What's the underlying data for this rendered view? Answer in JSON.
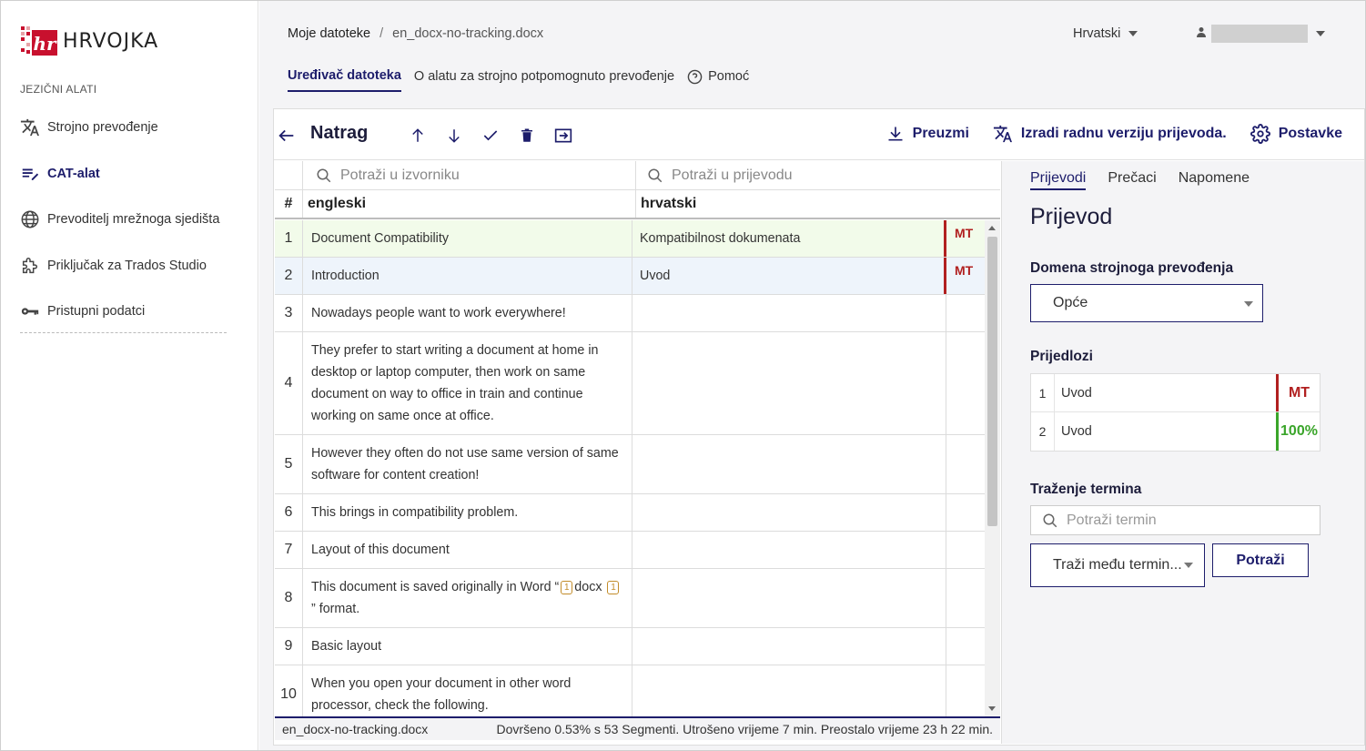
{
  "sidebar": {
    "logo_text": "HRVOJKA",
    "section_label": "JEZIČNI ALATI",
    "items": [
      {
        "label": "Strojno prevođenje",
        "icon": "translate-icon"
      },
      {
        "label": "CAT-alat",
        "icon": "edit-list-icon",
        "active": true
      },
      {
        "label": "Prevoditelj mrežnoga sjedišta",
        "icon": "globe-icon"
      },
      {
        "label": "Priključak za Trados Studio",
        "icon": "puzzle-icon"
      },
      {
        "label": "Pristupni podatci",
        "icon": "key-icon"
      }
    ]
  },
  "header": {
    "breadcrumb_root": "Moje datoteke",
    "breadcrumb_sep": "/",
    "breadcrumb_file": "en_docx-no-tracking.docx",
    "language": "Hrvatski",
    "tabs": [
      "Uređivač datoteka",
      "O alatu za strojno potpomognuto prevođenje",
      "Pomoć"
    ]
  },
  "toolbar": {
    "back_label": "Natrag",
    "download_label": "Preuzmi",
    "draft_label": "Izradi radnu verziju prijevoda.",
    "settings_label": "Postavke"
  },
  "grid": {
    "search_source_placeholder": "Potraži u izvorniku",
    "search_target_placeholder": "Potraži u prijevodu",
    "col_num": "#",
    "col_source": "engleski",
    "col_target": "hrvatski",
    "rows": [
      {
        "n": "1",
        "src": "Document Compatibility",
        "tgt": "Kompatibilnost dokumenata",
        "flag": "MT"
      },
      {
        "n": "2",
        "src": "Introduction",
        "tgt": "Uvod",
        "flag": "MT"
      },
      {
        "n": "3",
        "src": "Nowadays people want to work everywhere!",
        "tgt": "",
        "flag": ""
      },
      {
        "n": "4",
        "src": "They prefer to start writing a document at home in desktop or laptop computer, then work on same document on way to office in train and continue working on same once at office.",
        "tgt": "",
        "flag": ""
      },
      {
        "n": "5",
        "src": "However they often do not use same version of same software for content creation!",
        "tgt": "",
        "flag": ""
      },
      {
        "n": "6",
        "src": "This brings in compatibility problem.",
        "tgt": "",
        "flag": ""
      },
      {
        "n": "7",
        "src": "Layout of this document",
        "tgt": "",
        "flag": ""
      },
      {
        "n": "8",
        "src_a": "This document is saved originally in Word “",
        "tag_open": "1",
        "src_b": "docx",
        "tag_close": "1",
        "src_c": "” format.",
        "tgt": "",
        "flag": ""
      },
      {
        "n": "9",
        "src": "Basic layout",
        "tgt": "",
        "flag": ""
      },
      {
        "n": "10",
        "src": "When you open your document in other word processor, check the following.",
        "tgt": "",
        "flag": ""
      }
    ]
  },
  "status": {
    "file": "en_docx-no-tracking.docx",
    "progress": "Dovršeno 0.53% s 53 Segmenti. Utrošeno vrijeme 7 min. Preostalo vrijeme 23 h 22 min."
  },
  "right_panel": {
    "tabs": [
      "Prijevodi",
      "Prečaci",
      "Napomene"
    ],
    "heading": "Prijevod",
    "domain_label": "Domena strojnoga prevođenja",
    "domain_value": "Opće",
    "suggestions_label": "Prijedlozi",
    "suggestions": [
      {
        "n": "1",
        "text": "Uvod",
        "badge": "MT",
        "color": "#b12020"
      },
      {
        "n": "2",
        "text": "Uvod",
        "badge": "100%",
        "color": "#3aa52a"
      }
    ],
    "term_label": "Traženje termina",
    "term_placeholder": "Potraži termin",
    "term_select": "Traži među termin...",
    "term_button": "Potraži"
  },
  "colors": {
    "accent": "#1d1d6b",
    "mt": "#b12020",
    "match": "#3aa52a",
    "brand": "#c8102e"
  }
}
